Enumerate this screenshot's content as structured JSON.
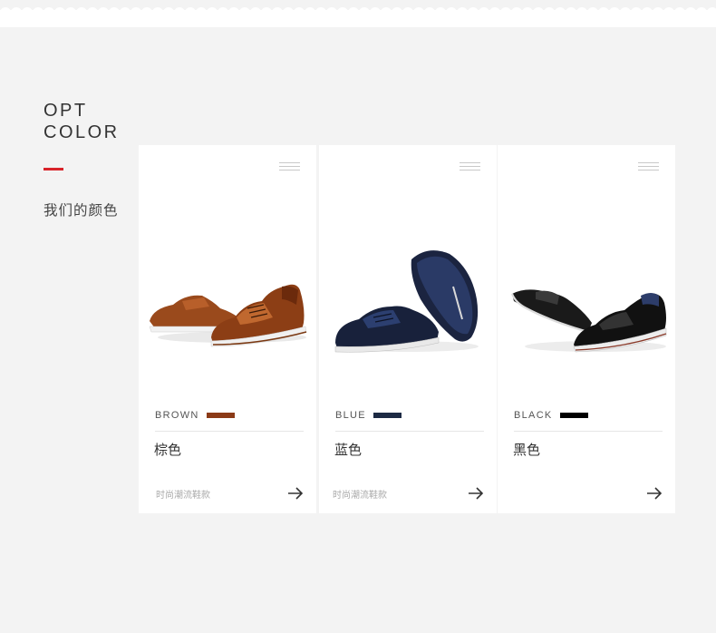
{
  "section": {
    "title_line1": "OPT",
    "title_line2": "COLOR",
    "subtitle": "我们的颜色",
    "accent_color": "#d8232a"
  },
  "cards": [
    {
      "color_name": "BROWN",
      "swatch": "#8b3a17",
      "cn_name": "棕色",
      "tag": "时尚潮流鞋款",
      "icon": "arrow-right-icon"
    },
    {
      "color_name": "BLUE",
      "swatch": "#1d2a44",
      "cn_name": "蓝色",
      "tag": "时尚潮流鞋款",
      "icon": "arrow-right-icon"
    },
    {
      "color_name": "BLACK",
      "swatch": "#000000",
      "cn_name": "黑色",
      "tag": "",
      "icon": "arrow-right-icon"
    }
  ]
}
